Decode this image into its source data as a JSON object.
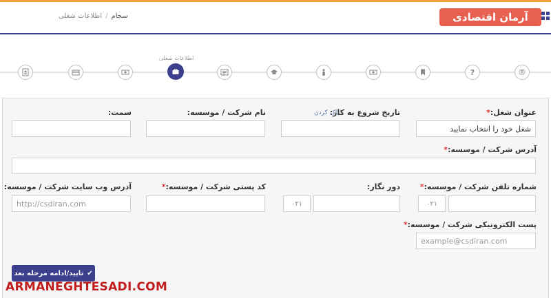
{
  "header": {
    "breadcrumb": [
      "سجام",
      "اطلاعات شغلی"
    ],
    "logo_text": "آرمان اقتصادی"
  },
  "steps": {
    "active_label": "اطلاعات شغلی",
    "items": [
      "ID-card",
      "credit-card",
      "money",
      "briefcase",
      "list",
      "graduation-cap",
      "person",
      "money",
      "bookmark",
      "question",
      "registered"
    ]
  },
  "form": {
    "job_title": {
      "label": "عنوان شغل:",
      "value": "شغل خود را انتخاب نمایید"
    },
    "start_date": {
      "label": "تاریخ شروع به کار:",
      "clear": "پاک کردن"
    },
    "company_name": {
      "label": "نام شرکت / موسسه:"
    },
    "position": {
      "label": "سمت:"
    },
    "company_address": {
      "label": "آدرس شرکت / موسسه:"
    },
    "company_phone": {
      "label": "شماره تلفن شرکت / موسسه:",
      "prefix": "۰۲۱"
    },
    "fax": {
      "label": "دور نگار:",
      "prefix": "۰۲۱"
    },
    "postal_code": {
      "label": "کد پستی شرکت / موسسه:"
    },
    "website": {
      "label": "آدرس وب سایت شرکت / موسسه:",
      "placeholder": "http://csdiran.com"
    },
    "email": {
      "label": "پست الکترونیکی شرکت / موسسه:",
      "placeholder": "example@csdiran.com"
    },
    "submit_label": "تایید/ادامه مرحله بعد"
  },
  "watermark": "ARMANEGHTESADI.COM",
  "colors": {
    "accent": "#3b3f8c",
    "top_stripe": "#f2a33a",
    "required": "#dd3333",
    "logo_bg": "#e8604f",
    "watermark": "#c21c1c"
  }
}
